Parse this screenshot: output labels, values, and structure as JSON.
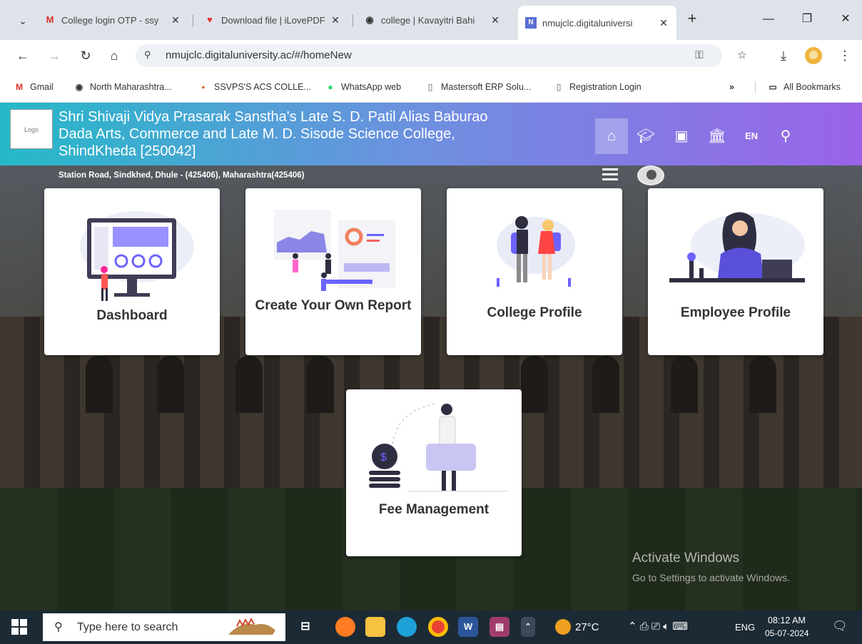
{
  "browser": {
    "tabs": [
      {
        "title": "College login OTP - ssy",
        "icon": "gmail-icon",
        "active": false
      },
      {
        "title": "Download file | iLovePDF",
        "icon": "ilovepdf-icon",
        "active": false
      },
      {
        "title": "college | Kavayitri Bahi",
        "icon": "university-icon",
        "active": false
      },
      {
        "title": "nmujclc.digitaluniversi",
        "icon": "site-icon",
        "active": true
      }
    ],
    "url": "nmujclc.digitaluniversity.ac/#/homeNew",
    "bookmarks": [
      {
        "label": "Gmail",
        "icon": "gmail-icon"
      },
      {
        "label": "North Maharashtra...",
        "icon": "university-icon"
      },
      {
        "label": "SSVPS'S ACS COLLE...",
        "icon": "site-icon"
      },
      {
        "label": "WhatsApp web",
        "icon": "whatsapp-icon"
      },
      {
        "label": "Mastersoft ERP Solu...",
        "icon": "doc-icon"
      },
      {
        "label": "Registration Login",
        "icon": "doc-icon"
      }
    ],
    "more_bookmarks": "»",
    "all_bookmarks": "All Bookmarks"
  },
  "header": {
    "logo_text": "Logo",
    "college_name_line1": "Shri Shivaji Vidya Prasarak Sanstha's Late S. D. Patil Alias Baburao",
    "college_name_line2": "Dada Arts, Commerce and Late M. D. Sisode Science College,",
    "college_name_line3": "ShindKheda [250042]",
    "lang": "EN",
    "address": "Station Road, Sindkhed, Dhule - (425406), Maharashtra(425406)"
  },
  "cards": [
    {
      "label": "Dashboard"
    },
    {
      "label": "Create Your Own Report"
    },
    {
      "label": "College Profile"
    },
    {
      "label": "Employee Profile"
    },
    {
      "label": "Fee Management"
    }
  ],
  "watermark": {
    "title": "Activate Windows",
    "subtitle": "Go to Settings to activate Windows."
  },
  "taskbar": {
    "search_placeholder": "Type here to search",
    "weather": "27°C",
    "lang": "ENG",
    "time": "08:12 AM",
    "date": "05-07-2024"
  }
}
